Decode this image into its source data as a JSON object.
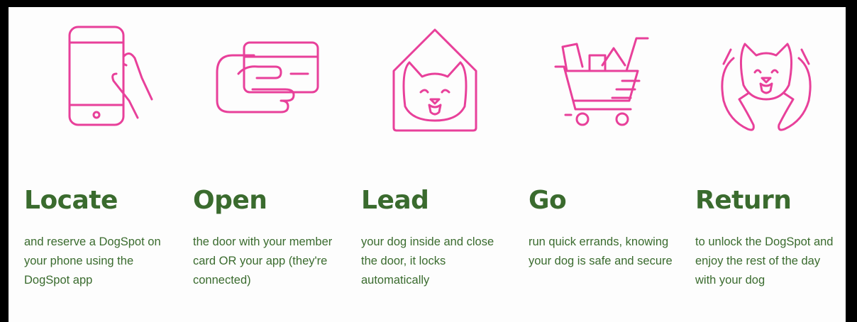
{
  "colors": {
    "icon": "#e8409a",
    "text": "#3a6b2e",
    "background": "#fdfdfd",
    "border": "#000000"
  },
  "steps": [
    {
      "icon": "phone-in-hand-icon",
      "title": "Locate",
      "description": "and reserve a DogSpot on your phone using the DogSpot app"
    },
    {
      "icon": "card-in-hand-icon",
      "title": "Open",
      "description": "the door with your member card OR your app (they're connected)"
    },
    {
      "icon": "dog-house-icon",
      "title": "Lead",
      "description": "your dog inside and close the door, it locks automatically"
    },
    {
      "icon": "shopping-cart-icon",
      "title": "Go",
      "description": "run quick errands, knowing your dog is safe and secure"
    },
    {
      "icon": "dog-in-hands-icon",
      "title": "Return",
      "description": "to unlock the DogSpot and enjoy the rest of the day with your dog"
    }
  ]
}
